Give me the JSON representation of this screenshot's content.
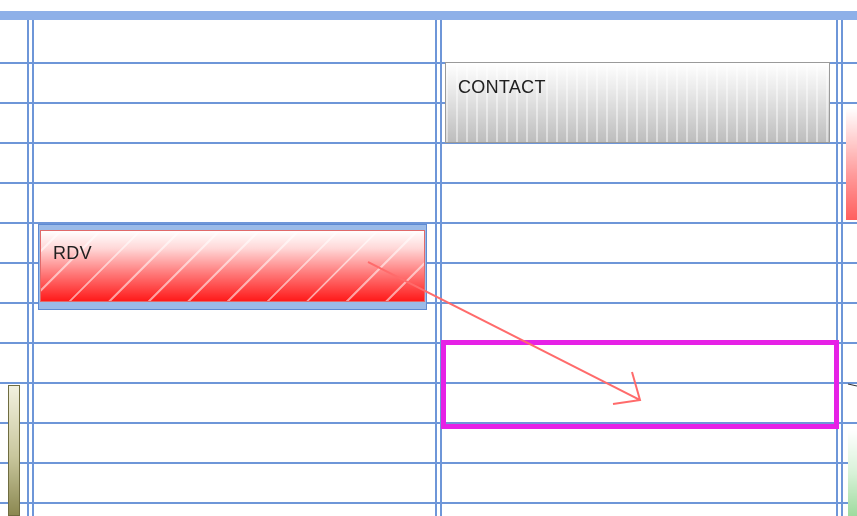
{
  "calendar": {
    "events": {
      "contact": {
        "label": "CONTACT"
      },
      "rdv": {
        "label": "RDV"
      }
    },
    "drag": {
      "type": "move-event"
    },
    "colors": {
      "grid": "#6e96d8",
      "header_bar": "#8eb0e8",
      "rdv_fill": "#ff1a1a",
      "contact_fill": "#bdbdbd",
      "drop_highlight": "#e621e6",
      "drag_arrow": "#ff6b6b"
    }
  }
}
